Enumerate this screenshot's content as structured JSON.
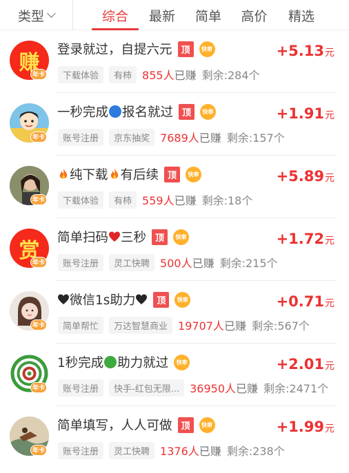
{
  "header": {
    "type_filter": "类型",
    "tabs": [
      {
        "label": "综合",
        "active": true
      },
      {
        "label": "最新",
        "active": false
      },
      {
        "label": "简单",
        "active": false
      },
      {
        "label": "高价",
        "active": false
      },
      {
        "label": "精选",
        "active": false
      }
    ]
  },
  "colors": {
    "accent": "#e63a3a",
    "badge": "#f7a23a",
    "top_tag": "#f05050",
    "fast_tag": "#ffb12c"
  },
  "tags": {
    "top": "顶",
    "fast": "快审",
    "avatar_badge": "年卡"
  },
  "unit": "元",
  "tasks": [
    {
      "title_a": "登录就过，自提六元",
      "title_b": "",
      "title_c": "",
      "reward": "+5.13",
      "chip1": "下载体验",
      "chip2": "有柿",
      "earned_count": "855人",
      "earned_suffix": "已赚",
      "remaining": "剩余:284个",
      "avatar_icon": "zhuan-avatar-icon",
      "avatar_text": "赚",
      "has_top": true,
      "has_fast": true
    },
    {
      "title_a": "一秒完成",
      "title_b": "报名就过",
      "title_c": "",
      "reward": "+1.91",
      "chip1": "账号注册",
      "chip2": "京东抽奖",
      "earned_count": "7689人",
      "earned_suffix": "已赚",
      "remaining": "剩余:157个",
      "avatar_icon": "cartoon-avatar-icon",
      "has_top": true,
      "has_fast": true
    },
    {
      "title_a": "纯下载",
      "title_b": "有后续",
      "title_c": "",
      "reward": "+5.89",
      "chip1": "下载体验",
      "chip2": "有柿",
      "earned_count": "559人",
      "earned_suffix": "已赚",
      "remaining": "剩余:18个",
      "avatar_icon": "person-avatar-icon",
      "has_top": true,
      "has_fast": true
    },
    {
      "title_a": "简单扫码",
      "title_b": "三秒",
      "title_c": "",
      "reward": "+1.72",
      "chip1": "账号注册",
      "chip2": "灵工快聘",
      "earned_count": "500人",
      "earned_suffix": "已赚",
      "remaining": "剩余:215个",
      "avatar_icon": "shang-avatar-icon",
      "avatar_text": "赏",
      "has_top": true,
      "has_fast": true
    },
    {
      "title_a": "微信1s助力",
      "title_b": "",
      "title_c": "",
      "reward": "+0.71",
      "chip1": "简单帮忙",
      "chip2": "万达智慧商业",
      "earned_count": "19707人",
      "earned_suffix": "已赚",
      "remaining": "剩余:567个",
      "avatar_icon": "girl-avatar-icon",
      "has_top": true,
      "has_fast": true
    },
    {
      "title_a": "1秒完成",
      "title_b": "助力就过",
      "title_c": "",
      "reward": "+2.01",
      "chip1": "账号注册",
      "chip2": "快手-红包无限...",
      "earned_count": "36950人",
      "earned_suffix": "已赚",
      "remaining": "剩余:2471个",
      "avatar_icon": "spiral-avatar-icon",
      "has_top": false,
      "has_fast": true
    },
    {
      "title_a": "简单填写，人人可做",
      "title_b": "",
      "title_c": "",
      "reward": "+1.99",
      "chip1": "账号注册",
      "chip2": "灵工快聘",
      "earned_count": "1376人",
      "earned_suffix": "已赚",
      "remaining": "剩余:238个",
      "avatar_icon": "painting-avatar-icon",
      "has_top": true,
      "has_fast": true
    }
  ]
}
